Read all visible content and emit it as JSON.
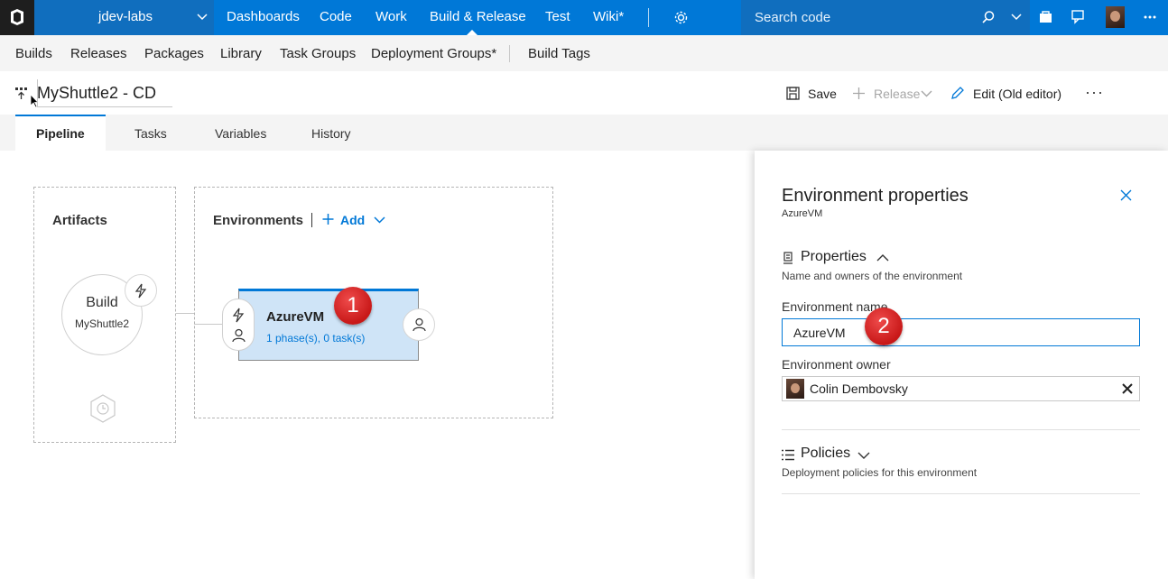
{
  "topbar": {
    "project": "jdev-labs",
    "nav": [
      "Dashboards",
      "Code",
      "Work",
      "Build & Release",
      "Test",
      "Wiki*"
    ],
    "active_nav": "Build & Release",
    "search_placeholder": "Search code"
  },
  "hubs": [
    "Builds",
    "Releases",
    "Packages",
    "Library",
    "Task Groups",
    "Deployment Groups*",
    "Build Tags"
  ],
  "definition": {
    "title": "MyShuttle2 - CD",
    "commands": {
      "save": "Save",
      "release": "Release",
      "edit_old": "Edit (Old editor)",
      "more": "···"
    }
  },
  "tabs": [
    "Pipeline",
    "Tasks",
    "Variables",
    "History"
  ],
  "active_tab": "Pipeline",
  "pipeline": {
    "artifacts_title": "Artifacts",
    "artifact": {
      "type": "Build",
      "name": "MyShuttle2"
    },
    "environments_title": "Environments",
    "add_label": "Add",
    "environment": {
      "name": "AzureVM",
      "summary": "1 phase(s), 0 task(s)"
    }
  },
  "annotations": {
    "badge1": "1",
    "badge2": "2"
  },
  "panel": {
    "title": "Environment properties",
    "subtitle": "AzureVM",
    "properties": {
      "title": "Properties",
      "description": "Name and owners of the environment",
      "name_label": "Environment name",
      "name_value": "AzureVM",
      "owner_label": "Environment owner",
      "owner_value": "Colin Dembovsky"
    },
    "policies": {
      "title": "Policies",
      "description": "Deployment policies for this environment"
    }
  },
  "colors": {
    "accent": "#0078d7",
    "topbar": "#0078d7",
    "badge": "#d32020",
    "env_card": "#cfe4f7"
  }
}
